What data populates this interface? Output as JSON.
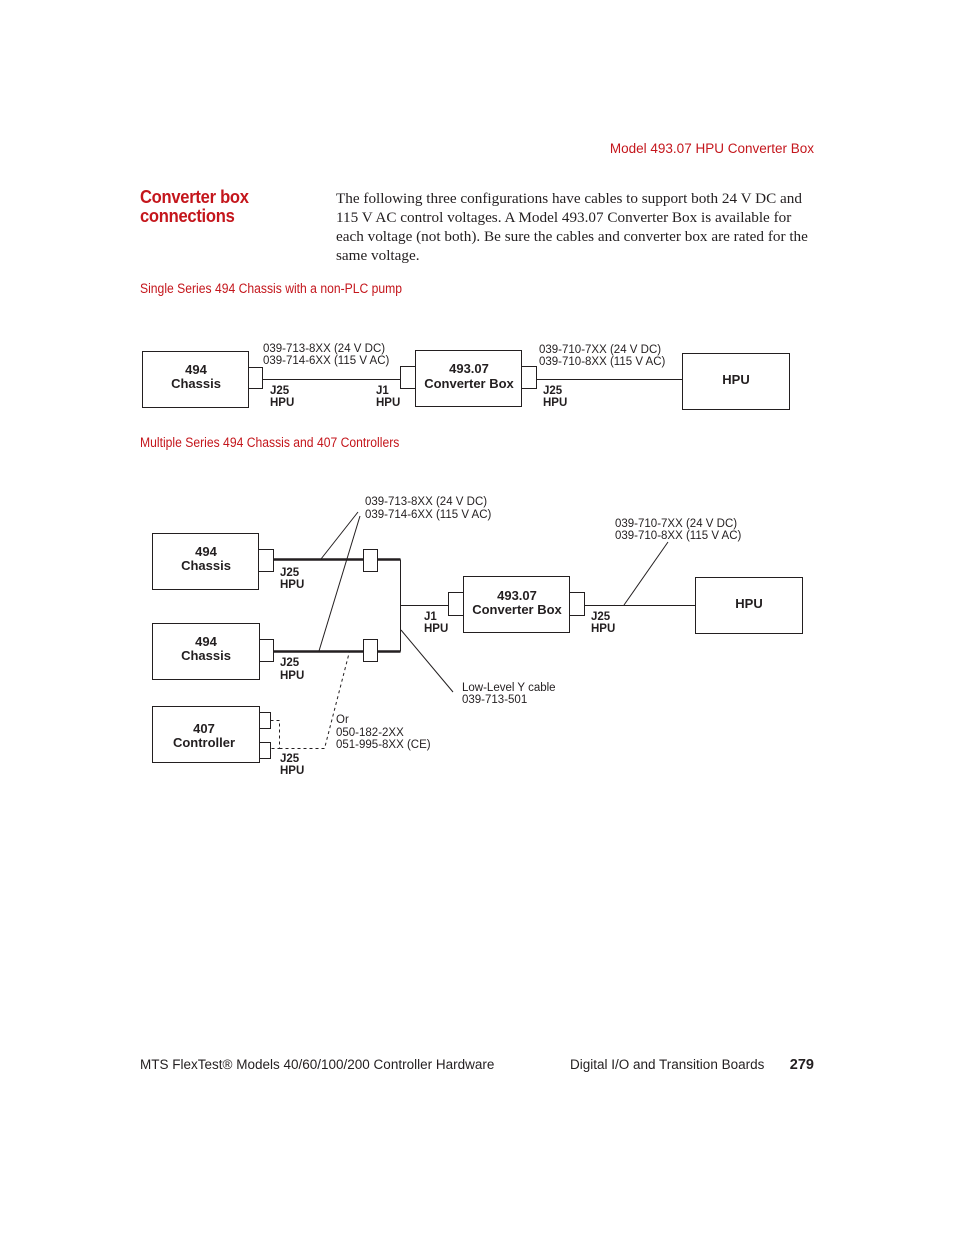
{
  "header": {
    "running_title": "Model 493.07 HPU Converter Box"
  },
  "section": {
    "title_line1": "Converter box",
    "title_line2": "connections",
    "body": "The following three configurations have cables to support both 24 V DC and 115 V AC control voltages. A Model 493.07 Converter Box is available for each voltage (not both). Be sure the cables and converter box are rated for the same voltage."
  },
  "figure1": {
    "caption": "Single Series 494 Chassis with a non-PLC pump",
    "chassis": {
      "line1": "494",
      "line2": "Chassis"
    },
    "converter": {
      "line1": "493.07",
      "line2": "Converter Box"
    },
    "hpu": {
      "label": "HPU"
    },
    "chassis_connector": {
      "line1": "J25",
      "line2": "HPU"
    },
    "converter_in_connector": {
      "line1": "J1",
      "line2": "HPU"
    },
    "converter_out_connector": {
      "line1": "J25",
      "line2": "HPU"
    },
    "cable_a": {
      "line1": "039-713-8XX (24 V DC)",
      "line2": "039-714-6XX (115 V AC)"
    },
    "cable_b": {
      "line1": "039-710-7XX (24 V DC)",
      "line2": "039-710-8XX (115 V AC)"
    }
  },
  "figure2": {
    "caption": "Multiple Series 494 Chassis and 407 Controllers",
    "chassis1": {
      "line1": "494",
      "line2": "Chassis"
    },
    "chassis2": {
      "line1": "494",
      "line2": "Chassis"
    },
    "controller": {
      "line1": "407",
      "line2": "Controller"
    },
    "converter": {
      "line1": "493.07",
      "line2": "Converter Box"
    },
    "hpu": {
      "label": "HPU"
    },
    "chassis1_connector": {
      "line1": "J25",
      "line2": "HPU"
    },
    "chassis2_connector": {
      "line1": "J25",
      "line2": "HPU"
    },
    "controller_connector": {
      "line1": "J25",
      "line2": "HPU"
    },
    "converter_in_connector": {
      "line1": "J1",
      "line2": "HPU"
    },
    "converter_out_connector": {
      "line1": "J25",
      "line2": "HPU"
    },
    "cable_a": {
      "line1": "039-713-8XX (24 V DC)",
      "line2": "039-714-6XX (115 V AC)"
    },
    "cable_b": {
      "line1": "039-710-7XX (24 V DC)",
      "line2": "039-710-8XX (115 V AC)"
    },
    "y_cable": {
      "line1": "Low-Level Y cable",
      "line2": "039-713-501"
    },
    "alt_cable": {
      "line1": "Or",
      "line2": "050-182-2XX",
      "line3": "051-995-8XX (CE)"
    }
  },
  "footer": {
    "manual_title": "MTS FlexTest® Models 40/60/100/200 Controller Hardware",
    "chapter": "Digital I/O and Transition Boards",
    "page_number": "279"
  }
}
